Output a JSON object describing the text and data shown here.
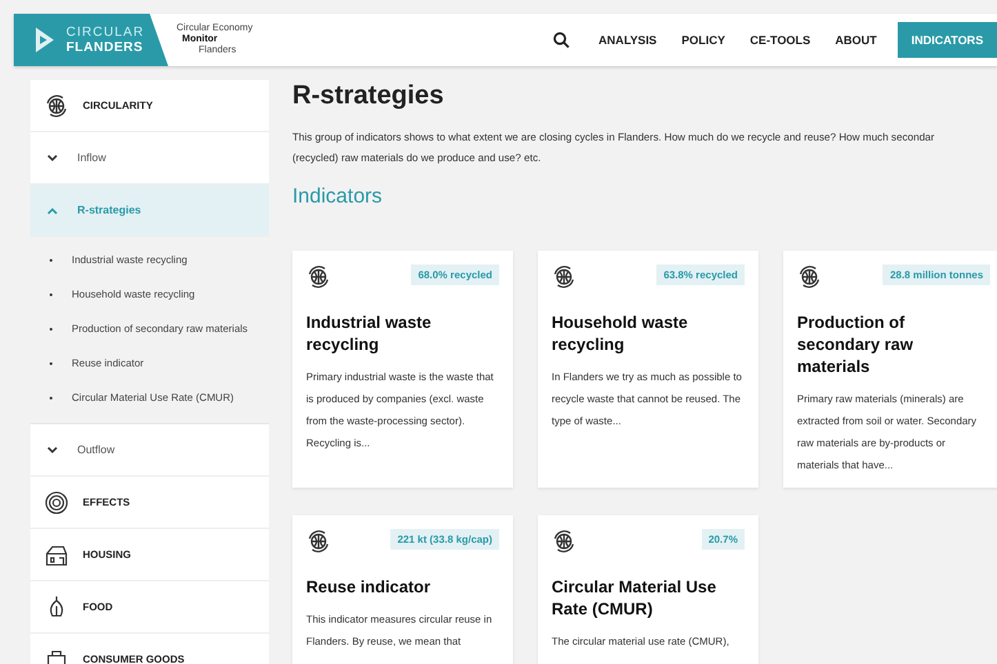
{
  "header": {
    "logo": {
      "line_1": "CIRCULAR",
      "line_2": "FLANDERS"
    },
    "tagline": {
      "line_1": "Circular Economy",
      "line_2": "Monitor",
      "line_3": "Flanders"
    },
    "nav": [
      {
        "label": "ANALYSIS",
        "selected": false
      },
      {
        "label": "POLICY",
        "selected": false
      },
      {
        "label": "CE-TOOLS",
        "selected": false
      },
      {
        "label": "ABOUT",
        "selected": false
      },
      {
        "label": "INDICATORS",
        "selected": true
      }
    ]
  },
  "sidebar": {
    "items": [
      {
        "kind": "category",
        "label": "CIRCULARITY",
        "children": [
          {
            "label": "Inflow",
            "expanded": false,
            "selected": false
          },
          {
            "label": "R-strategies",
            "expanded": true,
            "selected": true,
            "children": [
              {
                "label": "Industrial waste recycling"
              },
              {
                "label": "Household waste recycling"
              },
              {
                "label": "Production of secondary raw materials"
              },
              {
                "label": "Reuse indicator"
              },
              {
                "label": "Circular Material Use Rate (CMUR)"
              }
            ]
          },
          {
            "label": "Outflow",
            "expanded": false,
            "selected": false
          }
        ]
      },
      {
        "kind": "category",
        "label": "EFFECTS"
      },
      {
        "kind": "category",
        "label": "HOUSING"
      },
      {
        "kind": "category",
        "label": "FOOD"
      },
      {
        "kind": "category",
        "label": "CONSUMER GOODS"
      }
    ]
  },
  "main": {
    "title": "R-strategies",
    "intro_lines": [
      "This group of indicators shows to what extent we are closing cycles in Flanders. How much do we recycle and reuse? How much secondar",
      "(recycled) raw materials do we produce and use? etc."
    ],
    "section_title": "Indicators",
    "cards": [
      {
        "badge": "68.0% recycled",
        "title": "Industrial waste recycling",
        "text": "Primary industrial waste is the waste that is produced by companies (excl. waste from the waste-processing sector). Recycling is..."
      },
      {
        "badge": "63.8% recycled",
        "title": "Household waste recycling",
        "text": "In Flanders we try as much as possible to recycle waste that cannot be reused. The type of waste..."
      },
      {
        "badge": "28.8 million tonnes",
        "title": "Production of secondary raw materials",
        "text": "Primary raw materials (minerals) are extracted from soil or water. Secondary raw materials are by-products or materials that have..."
      },
      {
        "badge": "221 kt (33.8 kg/cap)",
        "title": "Reuse indicator",
        "text": "This indicator measures circular reuse in Flanders. By reuse, we mean that"
      },
      {
        "badge": "20.7%",
        "title": "Circular Material Use Rate (CMUR)",
        "text": "The circular material use rate (CMUR),"
      }
    ]
  }
}
